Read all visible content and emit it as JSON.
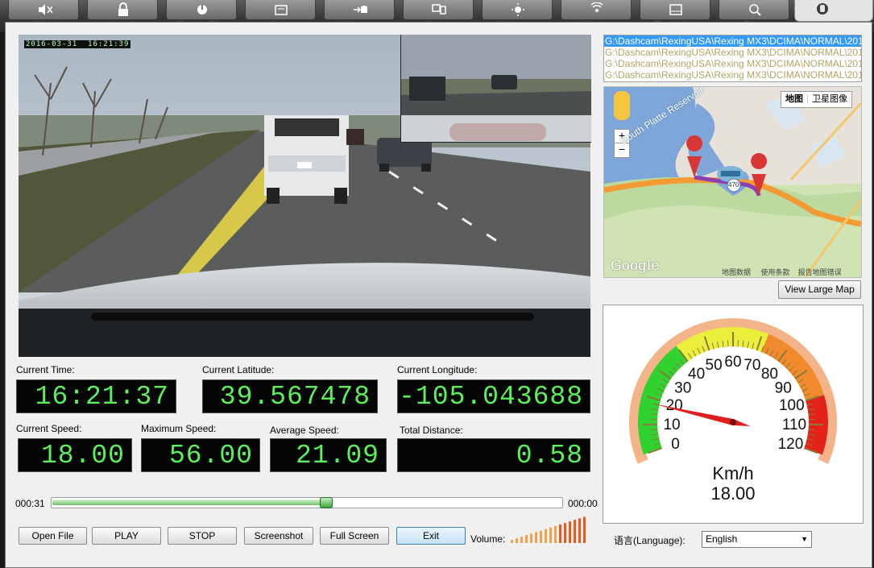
{
  "toolbar": {
    "items": [
      {
        "label": "Mute",
        "icon": "speaker-mute-icon"
      },
      {
        "label": "Lock",
        "icon": "lock-icon"
      },
      {
        "label": "Power Plan",
        "icon": "power-plan-icon"
      },
      {
        "label": "Sleep",
        "icon": "sleep-icon"
      },
      {
        "label": "Hibernate",
        "icon": "hibernate-icon"
      },
      {
        "label": "Output",
        "icon": "output-icon"
      },
      {
        "label": "Brightness",
        "icon": "brightness-icon"
      },
      {
        "label": "Wireless",
        "icon": "wireless-icon"
      },
      {
        "label": "Touch Pad",
        "icon": "touchpad-icon"
      },
      {
        "label": "Zoom",
        "icon": "zoom-icon"
      }
    ]
  },
  "video": {
    "osd_date": "2016-03-31",
    "osd_time": "16:21:39"
  },
  "info": {
    "current_time_label": "Current Time:",
    "current_time": "16:21:37",
    "latitude_label": "Current Latitude:",
    "latitude": "39.567478",
    "longitude_label": "Current Longitude:",
    "longitude": "-105.043688",
    "speed_label": "Current Speed:",
    "speed": "18.00",
    "max_speed_label": "Maximum Speed:",
    "max_speed": "56.00",
    "avg_speed_label": "Average Speed:",
    "avg_speed": "21.09",
    "distance_label": "Total Distance:",
    "distance": "0.58"
  },
  "playback": {
    "elapsed": "000:31",
    "remaining": "000:00",
    "progress": 0.54
  },
  "controls": {
    "open_file": "Open File",
    "play": "PLAY",
    "stop": "STOP",
    "screenshot": "Screenshot",
    "full_screen": "Full Screen",
    "exit": "Exit",
    "volume_label": "Volume:"
  },
  "files": [
    "G:\\Dashcam\\RexingUSA\\Rexing MX3\\DCIMA\\NORMAL\\201",
    "G:\\Dashcam\\RexingUSA\\Rexing MX3\\DCIMA\\NORMAL\\201",
    "G:\\Dashcam\\RexingUSA\\Rexing MX3\\DCIMA\\NORMAL\\201",
    "G:\\Dashcam\\RexingUSA\\Rexing MX3\\DCIMA\\NORMAL\\201"
  ],
  "map": {
    "tab_map": "地图",
    "tab_satellite": "卫星图像",
    "reservoir": "South Platte Reservoir",
    "route_shield": "470",
    "google": "Google",
    "footer_data": "地图数据",
    "footer_terms": "使用条款",
    "footer_report": "报告地图错误",
    "zoom_in": "+",
    "zoom_out": "−",
    "view_large": "View Large Map"
  },
  "gauge": {
    "unit": "Km/h",
    "value": 18.0,
    "value_text": "18.00",
    "min": 0,
    "max": 120,
    "ticks": [
      "0",
      "10",
      "20",
      "30",
      "40",
      "50",
      "60",
      "70",
      "80",
      "90",
      "100",
      "110",
      "120"
    ]
  },
  "language": {
    "label": "语言(Language):",
    "selected": "English"
  }
}
